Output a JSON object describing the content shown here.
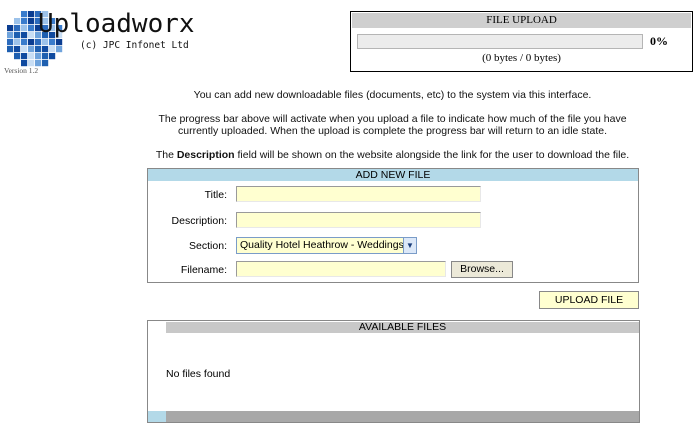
{
  "app": {
    "name": "Uploadworx",
    "copyright": "(c) JPC Infonet Ltd",
    "version": "Version 1.2"
  },
  "upload_status": {
    "title": "FILE UPLOAD",
    "percent_label": "0%",
    "progress": 0,
    "bytes_label": "(0 bytes / 0 bytes)"
  },
  "info": {
    "line1": "You can add new downloadable files (documents, etc) to the system via this interface.",
    "line2": "The progress bar above will activate when you upload a file to indicate how much of the file you have currently uploaded. When the upload is complete the progress bar will return to an idle state.",
    "line3_prefix": "The",
    "line3_bold": "Description",
    "line3_suffix": "field will be shown on the website alongside the link for the user to download the file."
  },
  "add_file": {
    "header": "ADD NEW FILE",
    "title_label": "Title:",
    "title_value": "",
    "description_label": "Description:",
    "description_value": "",
    "section_label": "Section:",
    "section_value": "Quality Hotel Heathrow - Weddings",
    "filename_label": "Filename:",
    "filename_value": "",
    "browse_label": "Browse...",
    "upload_label": "UPLOAD FILE"
  },
  "available_files": {
    "header": "AVAILABLE FILES",
    "empty_message": "No files found"
  },
  "colors": {
    "panel_header_blue": "#b3d9e8",
    "input_yellow": "#ffffd0",
    "gray_header": "#c8c8c8"
  }
}
